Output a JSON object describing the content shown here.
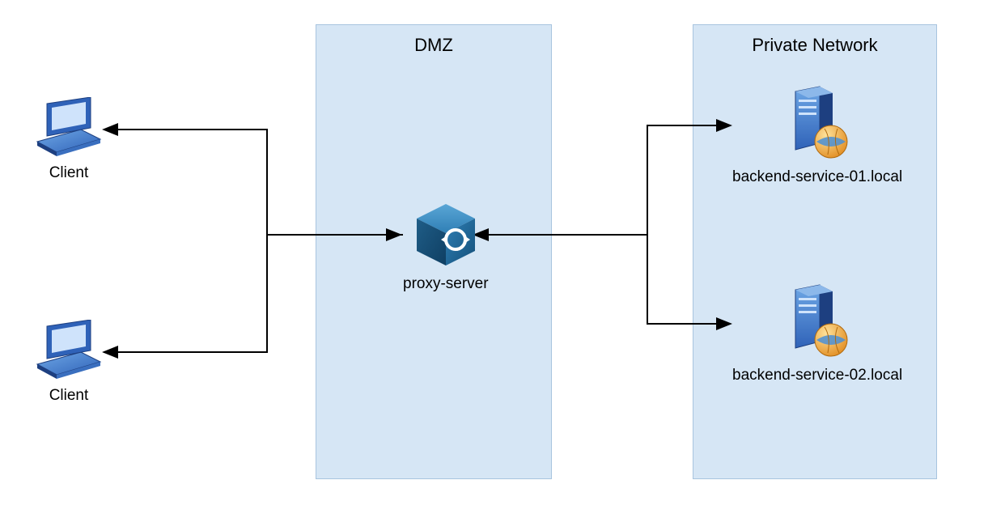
{
  "zones": {
    "dmz": {
      "title": "DMZ"
    },
    "private": {
      "title": "Private Network"
    }
  },
  "nodes": {
    "client1": {
      "label": "Client"
    },
    "client2": {
      "label": "Client"
    },
    "proxy": {
      "label": "proxy-server"
    },
    "backend1": {
      "label": "backend-service-01.local"
    },
    "backend2": {
      "label": "backend-service-02.local"
    }
  },
  "icons": {
    "client": "laptop-icon",
    "proxy": "cube-sync-icon",
    "backend": "web-server-icon"
  }
}
